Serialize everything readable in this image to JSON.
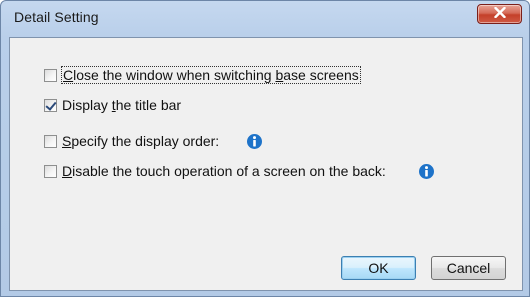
{
  "window": {
    "title": "Detail Setting"
  },
  "options": [
    {
      "label_pre": "",
      "label_mn": "C",
      "label_mid": "lose the window when switching ",
      "label_mn2": "b",
      "label_post": "ase screens",
      "checked": false
    },
    {
      "label_pre": "Display ",
      "label_mn": "t",
      "label_post": "he title bar",
      "checked": true
    },
    {
      "label_pre": "",
      "label_mn": "S",
      "label_post": "pecify the display order:",
      "checked": false
    },
    {
      "label_pre": "",
      "label_mn": "D",
      "label_post": "isable the touch operation of a screen on the back:",
      "checked": false
    }
  ],
  "buttons": {
    "ok_label": "OK",
    "cancel_label": "Cancel"
  },
  "icons": {
    "close": "close-icon",
    "info": "info-icon"
  },
  "colors": {
    "close_button": "#c4402a",
    "info_icon": "#1e73c9",
    "default_button_border": "#3c7fb1"
  }
}
